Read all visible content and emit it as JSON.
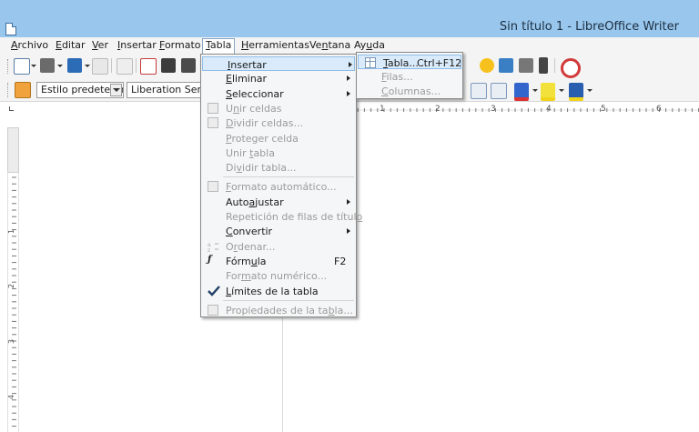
{
  "window": {
    "title": "Sin título 1 - LibreOffice Writer",
    "app_icon": "writer-document-icon"
  },
  "menubar": [
    {
      "pre": "",
      "key": "A",
      "post": "rchivo"
    },
    {
      "pre": "",
      "key": "E",
      "post": "ditar"
    },
    {
      "pre": "",
      "key": "V",
      "post": "er"
    },
    {
      "pre": "",
      "key": "I",
      "post": "nsertar"
    },
    {
      "pre": "",
      "key": "F",
      "post": "ormato"
    },
    {
      "pre": "",
      "key": "T",
      "post": "abla"
    },
    {
      "pre": "",
      "key": "H",
      "post": "erramientas"
    },
    {
      "pre": "Ve",
      "key": "n",
      "post": "tana"
    },
    {
      "pre": "Ay",
      "key": "u",
      "post": "da"
    }
  ],
  "toolbar": {
    "paragraph_style": "Estilo predeterm",
    "font_name": "Liberation Serif"
  },
  "ruler": {
    "h_numbers": [
      "1",
      "2",
      "3",
      "4",
      "5",
      "6"
    ],
    "v_numbers": [
      "1",
      "2",
      "3",
      "4"
    ]
  },
  "tabla_menu": {
    "items": [
      {
        "pre": "",
        "key": "I",
        "post": "nsertar",
        "icon": "",
        "shortcut": "",
        "submenu": true,
        "disabled": false,
        "highlighted": true
      },
      {
        "pre": "",
        "key": "E",
        "post": "liminar",
        "icon": "",
        "shortcut": "",
        "submenu": true,
        "disabled": false
      },
      {
        "pre": "",
        "key": "S",
        "post": "eleccionar",
        "icon": "",
        "shortcut": "",
        "submenu": true,
        "disabled": false
      },
      {
        "pre": "U",
        "key": "n",
        "post": "ir celdas",
        "icon": "merge-cells-icon",
        "shortcut": "",
        "submenu": false,
        "disabled": true
      },
      {
        "pre": "",
        "key": "D",
        "post": "ividir celdas...",
        "icon": "split-cells-icon",
        "shortcut": "",
        "submenu": false,
        "disabled": true
      },
      {
        "pre": "",
        "key": "P",
        "post": "roteger celda",
        "icon": "",
        "shortcut": "",
        "submenu": false,
        "disabled": true
      },
      {
        "pre": "Unir ",
        "key": "t",
        "post": "abla",
        "icon": "",
        "shortcut": "",
        "submenu": false,
        "disabled": true
      },
      {
        "pre": "Di",
        "key": "v",
        "post": "idir tabla...",
        "icon": "",
        "shortcut": "",
        "submenu": false,
        "disabled": true,
        "sep_after": true
      },
      {
        "pre": "",
        "key": "F",
        "post": "ormato automático...",
        "icon": "autoformat-icon",
        "shortcut": "",
        "submenu": false,
        "disabled": true
      },
      {
        "pre": "Auto",
        "key": "a",
        "post": "justar",
        "icon": "",
        "shortcut": "",
        "submenu": true,
        "disabled": false
      },
      {
        "pre": "Repetición de filas de títul",
        "key": "o",
        "post": "",
        "icon": "",
        "shortcut": "",
        "submenu": false,
        "disabled": true
      },
      {
        "pre": "",
        "key": "C",
        "post": "onvertir",
        "icon": "",
        "shortcut": "",
        "submenu": true,
        "disabled": false
      },
      {
        "pre": "O",
        "key": "r",
        "post": "denar...",
        "icon": "sort-icon",
        "shortcut": "",
        "submenu": false,
        "disabled": true
      },
      {
        "pre": "Fórm",
        "key": "u",
        "post": "la",
        "icon": "formula-icon",
        "shortcut": "F2",
        "submenu": false,
        "disabled": false
      },
      {
        "pre": "For",
        "key": "m",
        "post": "ato numérico...",
        "icon": "",
        "shortcut": "",
        "submenu": false,
        "disabled": true
      },
      {
        "pre": "",
        "key": "L",
        "post": "ímites de la tabla",
        "icon": "checkmark-icon",
        "shortcut": "",
        "submenu": false,
        "disabled": false,
        "sep_after": true
      },
      {
        "pre": "Propiedades de la ta",
        "key": "b",
        "post": "la...",
        "icon": "table-properties-icon",
        "shortcut": "",
        "submenu": false,
        "disabled": true
      }
    ]
  },
  "insertar_submenu": {
    "items": [
      {
        "pre": "",
        "key": "T",
        "post": "abla...",
        "shortcut": "Ctrl+F12",
        "icon": "table-icon",
        "disabled": false,
        "highlighted": true
      },
      {
        "pre": "",
        "key": "F",
        "post": "ilas...",
        "shortcut": "",
        "icon": "",
        "disabled": true
      },
      {
        "pre": "",
        "key": "C",
        "post": "olumnas...",
        "shortcut": "",
        "icon": "",
        "disabled": true
      }
    ]
  }
}
